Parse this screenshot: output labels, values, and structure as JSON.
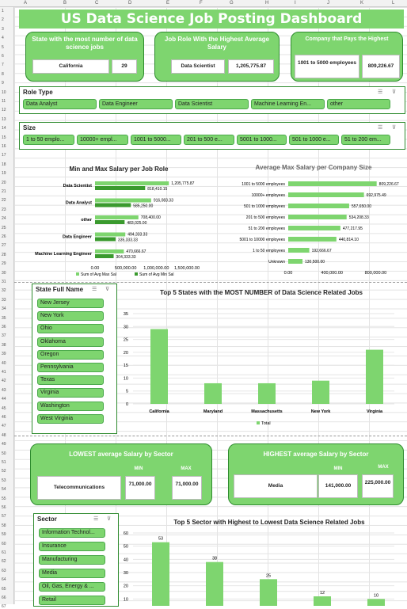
{
  "columns": [
    "A",
    "B",
    "C",
    "D",
    "E",
    "F",
    "G",
    "H",
    "I",
    "J",
    "K",
    "L"
  ],
  "rows": [
    "1",
    "2",
    "3",
    "4",
    "5",
    "6",
    "7",
    "8",
    "9",
    "10",
    "11",
    "12",
    "13",
    "14",
    "15",
    "16",
    "17",
    "18",
    "19",
    "20",
    "21",
    "22",
    "23",
    "24",
    "25",
    "26",
    "27",
    "28",
    "29",
    "30",
    "31",
    "32",
    "33",
    "34",
    "35",
    "36",
    "37",
    "38",
    "39",
    "40",
    "41",
    "42",
    "43",
    "44",
    "45",
    "46",
    "47",
    "48",
    "49",
    "50",
    "51",
    "52",
    "53",
    "54",
    "55",
    "56",
    "57",
    "58",
    "59",
    "60",
    "61",
    "62",
    "63",
    "64",
    "65",
    "66",
    "67"
  ],
  "title": "US Data Science Job Posting Dashboard",
  "kpi1": {
    "label": "State with the most number of data science jobs",
    "name": "California",
    "count": "29"
  },
  "kpi2": {
    "label": "Job Role With the Highest Average Salary",
    "name": "Data Scientist",
    "value": "1,205,775.87"
  },
  "kpi3": {
    "label": "Company that Pays the Highest",
    "name": "1001 to 5000 employees",
    "value": "809,226.67"
  },
  "role_slicer": {
    "title": "Role Type",
    "items": [
      "Data Analyst",
      "Data Engineer",
      "Data Scientist",
      "Machine Learning En...",
      "other"
    ]
  },
  "size_slicer": {
    "title": "Size",
    "items": [
      "1 to 50 emplo...",
      "10000+ empl...",
      "1001 to 5000...",
      "201 to 500 e...",
      "5001 to 1000...",
      "501 to 1000 e...",
      "51 to 200 em..."
    ]
  },
  "state_slicer": {
    "title": "State Full Name",
    "items": [
      "New Jersey",
      "New York",
      "Ohio",
      "Oklahoma",
      "Oregon",
      "Pennsylvania",
      "Texas",
      "Virginia",
      "Washington",
      "West Virginia"
    ]
  },
  "sector_slicer": {
    "title": "Sector",
    "items": [
      "Information Technol...",
      "Insurance",
      "Manufacturing",
      "Media",
      "Oil, Gas, Energy & ...",
      "Retail"
    ]
  },
  "lowest": {
    "label": "LOWEST average Salary by Sector",
    "sector": "Telecommunications",
    "min_label": "MIN",
    "max_label": "MAX",
    "min": "71,000.00",
    "max": "71,000.00"
  },
  "highest": {
    "label": "HIGHEST average Salary by Sector",
    "sector": "Media",
    "min_label": "MIN",
    "max_label": "MAX",
    "min": "141,000.00",
    "max": "225,000.00"
  },
  "colors": {
    "green": "#7ed56f",
    "dark": "#3a9a2e",
    "border": "#2e8b2e"
  },
  "chart_data": [
    {
      "type": "bar",
      "title": "Min and Max Salary per Job Role",
      "categories": [
        "Data Scientist",
        "Data Analyst",
        "other",
        "Data Engineer",
        "Machine Learning Engineer"
      ],
      "series": [
        {
          "name": "Sum of Avg Max Sal",
          "values": [
            1205775.87,
            916083.33,
            708400.0,
            494333.33,
            470666.67
          ]
        },
        {
          "name": "Sum of Avg Min Sal",
          "values": [
            818410.15,
            585250.0,
            483025.0,
            335333.33,
            304333.33
          ]
        }
      ],
      "labels_max": [
        "1,205,775.87",
        "916,083.33",
        "708,400.00",
        "494,333.33",
        "470,666.67"
      ],
      "labels_min": [
        "818,410.15",
        "585,250.00",
        "483,025.00",
        "335,333.33",
        "304,333.33"
      ],
      "ticks": [
        "0.00",
        "500,000.00",
        "1,000,000.00",
        "1,500,000.00"
      ],
      "xlim": [
        0,
        1500000
      ],
      "legend": "bottom"
    },
    {
      "type": "bar",
      "title": "Average Max Salary per Company Size",
      "categories": [
        "1001 to 5000 employees",
        "10000+ employees",
        "501 to 1000 employees",
        "201 to 500 employees",
        "51 to 200 employees",
        "5001 to 10000 employees",
        "1 to 50 employees",
        "Unknown"
      ],
      "values": [
        809226.67,
        692975.49,
        557650.0,
        534208.33,
        477217.95,
        440814.1,
        192666.67,
        130500.0
      ],
      "labels": [
        "809,226.67",
        "692,975.49",
        "557,650.00",
        "534,208.33",
        "477,217.95",
        "440,814.10",
        "192,666.67",
        "130,500.00"
      ],
      "ticks": [
        "0.00",
        "400,000.00",
        "800,000.00"
      ],
      "xlim": [
        0,
        1000000
      ]
    },
    {
      "type": "bar",
      "title": "Top 5 States with the MOST NUMBER of Data Science Related Jobs",
      "categories": [
        "California",
        "Maryland",
        "Massachusetts",
        "New York",
        "Virginia"
      ],
      "values": [
        29,
        8,
        8,
        9,
        21
      ],
      "ylim": [
        0,
        35
      ],
      "yticks": [
        "0",
        "5",
        "10",
        "15",
        "20",
        "25",
        "30",
        "35"
      ],
      "legend": "Total"
    },
    {
      "type": "bar",
      "title": "Top 5 Sector with Highest to Lowest Data Science Related Jobs",
      "values": [
        53,
        38,
        25,
        12,
        10
      ],
      "ylim": [
        0,
        60
      ],
      "yticks": [
        "0",
        "10",
        "20",
        "30",
        "40",
        "50",
        "60"
      ]
    }
  ]
}
